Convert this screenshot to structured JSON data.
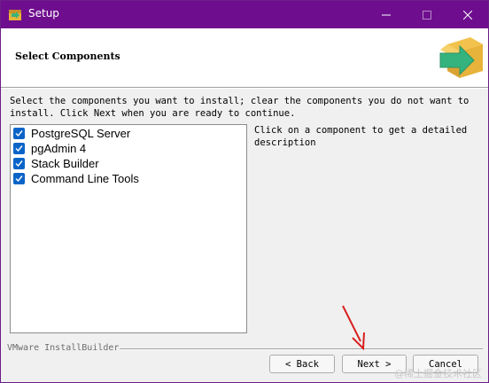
{
  "window": {
    "title": "Setup",
    "minimize_icon": "minimize-icon",
    "maximize_icon": "maximize-icon",
    "close_icon": "close-icon"
  },
  "header": {
    "title": "Select Components",
    "graphic_icon": "install-box-arrow-icon"
  },
  "instructions": "Select the components you want to install; clear the components you do not want to\ninstall. Click Next when you are ready to continue.",
  "components": [
    {
      "label": "PostgreSQL Server",
      "checked": true
    },
    {
      "label": "pgAdmin 4",
      "checked": true
    },
    {
      "label": "Stack Builder",
      "checked": true
    },
    {
      "label": "Command Line Tools",
      "checked": true
    }
  ],
  "description": "Click on a component to get a detailed\ndescription",
  "footer": {
    "brand": "VMware InstallBuilder",
    "back_label": "< Back",
    "next_label": "Next >",
    "cancel_label": "Cancel"
  },
  "watermark": "@稀土掘金技术社区",
  "colors": {
    "titlebar": "#6e0e8e",
    "checkbox": "#0a64c8",
    "annotation_arrow": "#d81e1e"
  }
}
